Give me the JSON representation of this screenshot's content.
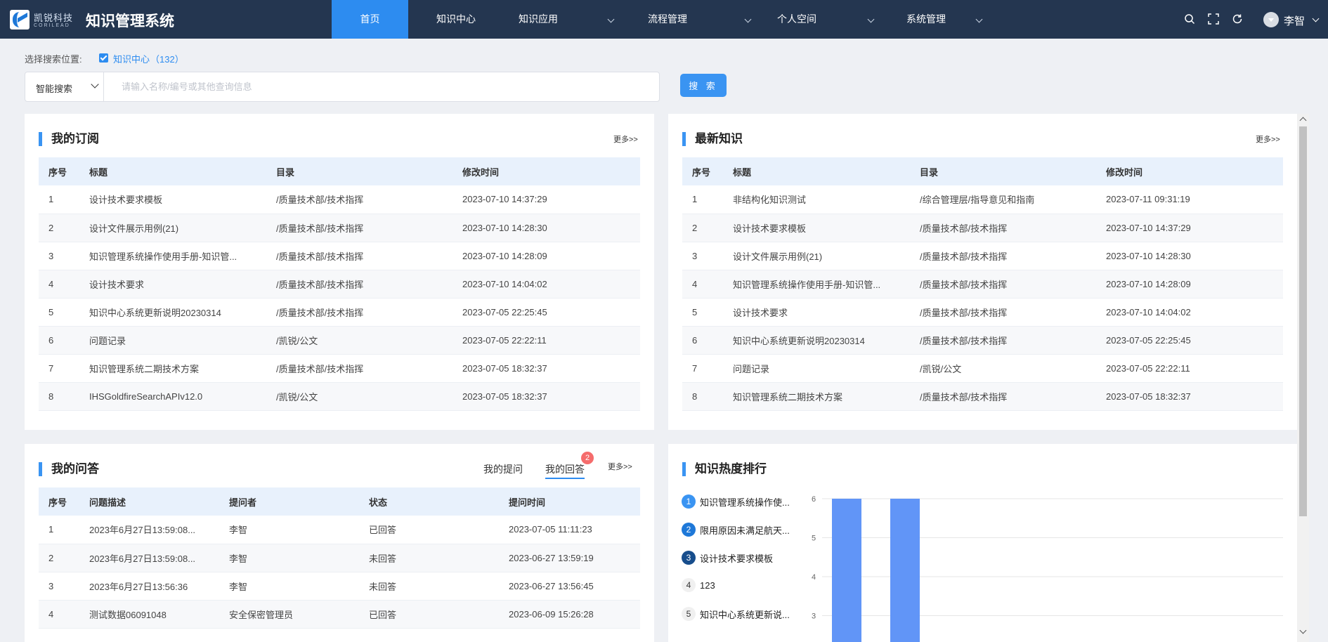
{
  "header": {
    "brand_cn": "凯锐科技",
    "brand_en": "CORILEAD",
    "app_title": "知识管理系统",
    "nav": [
      {
        "label": "首页",
        "active": true
      },
      {
        "label": "知识中心"
      },
      {
        "label": "知识应用"
      },
      {
        "label": "流程管理"
      },
      {
        "label": "个人空间"
      },
      {
        "label": "系统管理"
      }
    ],
    "user": "李智"
  },
  "search": {
    "scope_label": "选择搜索位置:",
    "scope_option": "知识中心",
    "scope_count": "（132）",
    "mode": "智能搜索",
    "placeholder": "请输入名称/编号或其他查询信息",
    "button": "搜 索"
  },
  "subscriptions": {
    "title": "我的订阅",
    "more": "更多>>",
    "headers": [
      "序号",
      "标题",
      "目录",
      "修改时间"
    ],
    "rows": [
      [
        "1",
        "设计技术要求模板",
        "/质量技术部/技术指挥",
        "2023-07-10 14:37:29"
      ],
      [
        "2",
        "设计文件展示用例(21)",
        "/质量技术部/技术指挥",
        "2023-07-10 14:28:30"
      ],
      [
        "3",
        "知识管理系统操作使用手册-知识管...",
        "/质量技术部/技术指挥",
        "2023-07-10 14:28:09"
      ],
      [
        "4",
        "设计技术要求",
        "/质量技术部/技术指挥",
        "2023-07-10 14:04:02"
      ],
      [
        "5",
        "知识中心系统更新说明20230314",
        "/质量技术部/技术指挥",
        "2023-07-05 22:25:45"
      ],
      [
        "6",
        "问题记录",
        "/凯锐/公文",
        "2023-07-05 22:22:11"
      ],
      [
        "7",
        "知识管理系统二期技术方案",
        "/质量技术部/技术指挥",
        "2023-07-05 18:32:37"
      ],
      [
        "8",
        "IHSGoldfireSearchAPIv12.0",
        "/凯锐/公文",
        "2023-07-05 18:32:37"
      ]
    ]
  },
  "latest": {
    "title": "最新知识",
    "more": "更多>>",
    "headers": [
      "序号",
      "标题",
      "目录",
      "修改时间"
    ],
    "rows": [
      [
        "1",
        "非结构化知识测试",
        "/综合管理层/指导意见和指南",
        "2023-07-11 09:31:19"
      ],
      [
        "2",
        "设计技术要求模板",
        "/质量技术部/技术指挥",
        "2023-07-10 14:37:29"
      ],
      [
        "3",
        "设计文件展示用例(21)",
        "/质量技术部/技术指挥",
        "2023-07-10 14:28:30"
      ],
      [
        "4",
        "知识管理系统操作使用手册-知识管...",
        "/质量技术部/技术指挥",
        "2023-07-10 14:28:09"
      ],
      [
        "5",
        "设计技术要求",
        "/质量技术部/技术指挥",
        "2023-07-10 14:04:02"
      ],
      [
        "6",
        "知识中心系统更新说明20230314",
        "/质量技术部/技术指挥",
        "2023-07-05 22:25:45"
      ],
      [
        "7",
        "问题记录",
        "/凯锐/公文",
        "2023-07-05 22:22:11"
      ],
      [
        "8",
        "知识管理系统二期技术方案",
        "/质量技术部/技术指挥",
        "2023-07-05 18:32:37"
      ]
    ]
  },
  "qa": {
    "title": "我的问答",
    "tab_ask": "我的提问",
    "tab_answer": "我的回答",
    "answer_badge": "2",
    "more": "更多>>",
    "headers": [
      "序号",
      "问题描述",
      "提问者",
      "状态",
      "提问时间"
    ],
    "rows": [
      [
        "1",
        "2023年6月27日13:59:08...",
        "李智",
        "已回答",
        "2023-07-05 11:11:23"
      ],
      [
        "2",
        "2023年6月27日13:59:08...",
        "李智",
        "未回答",
        "2023-06-27 13:59:19"
      ],
      [
        "3",
        "2023年6月27日13:56:36",
        "李智",
        "未回答",
        "2023-06-27 13:56:45"
      ],
      [
        "4",
        "测试数据06091048",
        "安全保密管理员",
        "已回答",
        "2023-06-09 15:26:28"
      ]
    ]
  },
  "ranking": {
    "title": "知识热度排行",
    "items": [
      {
        "rank": "1",
        "label": "知识管理系统操作使...",
        "color": "#3a94f2"
      },
      {
        "rank": "2",
        "label": "限用原因未满足航天...",
        "color": "#1e78d8"
      },
      {
        "rank": "3",
        "label": "设计技术要求模板",
        "color": "#174d8c"
      },
      {
        "rank": "4",
        "label": "123",
        "color": "#f0f0f0"
      },
      {
        "rank": "5",
        "label": "知识中心系统更新说...",
        "color": "#f0f0f0"
      }
    ]
  },
  "chart_data": {
    "type": "bar",
    "y_ticks": [
      "6",
      "5",
      "4",
      "3"
    ],
    "ylim": [
      3,
      6
    ],
    "values": [
      6,
      6
    ],
    "bar_color": "#6195f7",
    "grid": true
  }
}
